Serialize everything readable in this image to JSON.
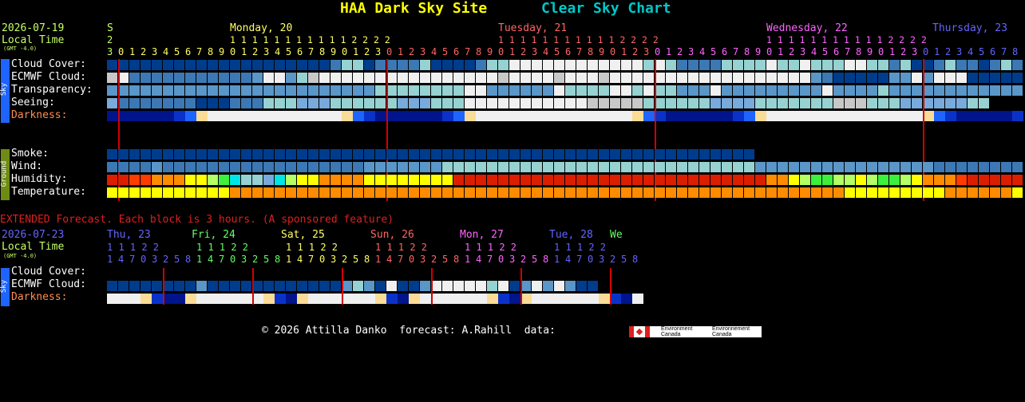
{
  "title": {
    "site": "HAA Dark Sky Site",
    "chart": "Clear Sky Chart",
    "site_color": "#ffff00",
    "chart_color": "#00c8c8"
  },
  "main": {
    "date": "2026-07-19",
    "local_time": "Local Time",
    "gmt": "(GMT -4.0)",
    "days": [
      {
        "label": "S",
        "color": "#c8ff64"
      },
      {
        "label": "Monday, 20",
        "color": "#ffff64"
      },
      {
        "label": "Tuesday, 21",
        "color": "#ff6464"
      },
      {
        "label": "Wednesday, 22",
        "color": "#ff64ff"
      },
      {
        "label": "Thursday, 23",
        "color": "#6464ff"
      }
    ],
    "tens_line_s": "2",
    "tens_line_mon": "1 1 1 1 1 1 1 1 1 1 1 2 2 2 2",
    "tens_line_tue": "1 1 1 1 1 1 1 1 1 1 1 2 2 2 2",
    "tens_line_wed": "1 1 1 1 1 1 1 1 1 1 1 2 2 2 2",
    "hours_line": "3 0 1 2 3 4 5 6 7 8 9 0 1 2 3 4 5 6 7 8 9 0 1 2 3 0 1 2 3 4 5 6 7 8 9 0 1 2 3 4 5 6 7 8 9 0 1 2 3 0 1 2 3 4 5 6 7 8 9 0 1 2 3 4 5 6 7 8 9 0 1 2 3 0 1 2 3 4 5 6 7 8",
    "sky_rows": [
      {
        "label": "Cloud Cover:",
        "color": "#ffffff"
      },
      {
        "label": "ECMWF Cloud:",
        "color": "#ffffff"
      },
      {
        "label": "Transparency:",
        "color": "#ffffff"
      },
      {
        "label": "Seeing:",
        "color": "#ffffff"
      },
      {
        "label": "Darkness:",
        "color": "#ff8c50"
      }
    ],
    "ground_rows": [
      {
        "label": "Smoke:",
        "color": "#ffffff"
      },
      {
        "label": "Wind:",
        "color": "#ffffff"
      },
      {
        "label": "Humidity:",
        "color": "#ffffff"
      },
      {
        "label": "Temperature:",
        "color": "#ffffff"
      }
    ],
    "sky_tab": "Sky",
    "ground_tab": "Ground"
  },
  "extended": {
    "banner": "EXTENDED Forecast. Each block is 3 hours. (A sponsored feature)",
    "banner_color": "#dc2020",
    "date": "2026-07-23",
    "local_time": "Local Time",
    "gmt": "(GMT -4.0)",
    "days": [
      {
        "label": "Thu, 23",
        "color": "#6464ff"
      },
      {
        "label": "Fri, 24",
        "color": "#64ff64"
      },
      {
        "label": "Sat, 25",
        "color": "#ffff64"
      },
      {
        "label": "Sun, 26",
        "color": "#ff6464"
      },
      {
        "label": "Mon, 27",
        "color": "#ff64ff"
      },
      {
        "label": "Tue, 28",
        "color": "#6464ff"
      },
      {
        "label": "We",
        "color": "#64ff64"
      }
    ],
    "tens_line": "1 1 1 2 2",
    "hours_line": "1 4 7 0 3 2 5 8 1 4 7 0 3 2 5 8 1 4 7 0 3 2 5 8 1 4 7 0 3 2 5 8 1 4 7 0 3 2 5 8 1 4 7 0 3 2 5 8",
    "rows": [
      {
        "label": "Cloud Cover:",
        "color": "#ffffff"
      },
      {
        "label": "ECMWF Cloud:",
        "color": "#ffffff"
      },
      {
        "label": "Darkness:",
        "color": "#ff8c50"
      }
    ],
    "sky_tab": "Sky"
  },
  "footer": {
    "text": "© 2026 Attilla Danko  forecast: A.Rahill  data:",
    "ec_en": "Environment Canada",
    "ec_fr": "Environnement Canada"
  }
}
